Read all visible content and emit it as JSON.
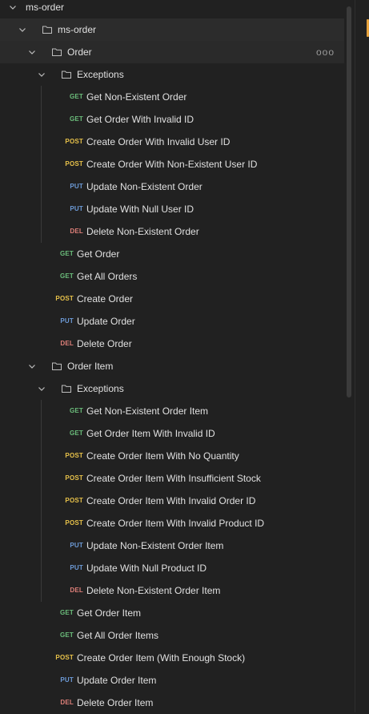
{
  "method_colors": {
    "GET": "#6bbd7b",
    "POST": "#e8c24a",
    "PUT": "#6d9bd8",
    "DEL": "#e0807a"
  },
  "tree": {
    "root": {
      "label": "ms-order"
    },
    "collection": {
      "label": "ms-order"
    },
    "order_folder": {
      "label": "Order",
      "more": "ooo"
    },
    "order_exceptions": {
      "label": "Exceptions"
    },
    "order_exception_requests": [
      {
        "method": "GET",
        "name": "Get Non-Existent Order"
      },
      {
        "method": "GET",
        "name": "Get Order With Invalid ID"
      },
      {
        "method": "POST",
        "name": "Create Order With Invalid User ID"
      },
      {
        "method": "POST",
        "name": "Create Order With Non-Existent User ID"
      },
      {
        "method": "PUT",
        "name": "Update Non-Existent Order"
      },
      {
        "method": "PUT",
        "name": "Update With Null User ID"
      },
      {
        "method": "DEL",
        "name": "Delete Non-Existent Order"
      }
    ],
    "order_requests": [
      {
        "method": "GET",
        "name": "Get Order"
      },
      {
        "method": "GET",
        "name": "Get All Orders"
      },
      {
        "method": "POST",
        "name": "Create Order"
      },
      {
        "method": "PUT",
        "name": "Update Order"
      },
      {
        "method": "DEL",
        "name": "Delete Order"
      }
    ],
    "order_item_folder": {
      "label": "Order Item"
    },
    "order_item_exceptions": {
      "label": "Exceptions"
    },
    "order_item_exception_requests": [
      {
        "method": "GET",
        "name": "Get Non-Existent Order Item"
      },
      {
        "method": "GET",
        "name": "Get Order Item With Invalid ID"
      },
      {
        "method": "POST",
        "name": "Create Order Item With No Quantity"
      },
      {
        "method": "POST",
        "name": "Create Order Item With Insufficient Stock"
      },
      {
        "method": "POST",
        "name": "Create Order Item With Invalid Order ID"
      },
      {
        "method": "POST",
        "name": "Create Order Item With Invalid Product ID"
      },
      {
        "method": "PUT",
        "name": "Update Non-Existent Order Item"
      },
      {
        "method": "PUT",
        "name": "Update With Null Product ID"
      },
      {
        "method": "DEL",
        "name": "Delete Non-Existent Order Item"
      }
    ],
    "order_item_requests": [
      {
        "method": "GET",
        "name": "Get Order Item"
      },
      {
        "method": "GET",
        "name": "Get All Order Items"
      },
      {
        "method": "POST",
        "name": "Create Order Item (With Enough Stock)"
      },
      {
        "method": "PUT",
        "name": "Update Order Item"
      },
      {
        "method": "DEL",
        "name": "Delete Order Item"
      }
    ]
  }
}
